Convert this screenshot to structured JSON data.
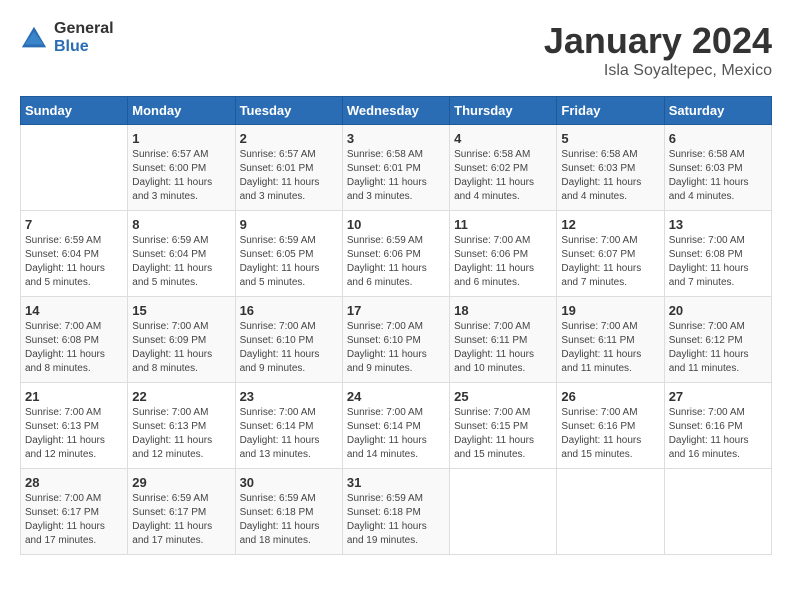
{
  "logo": {
    "general": "General",
    "blue": "Blue"
  },
  "title": "January 2024",
  "location": "Isla Soyaltepec, Mexico",
  "days_of_week": [
    "Sunday",
    "Monday",
    "Tuesday",
    "Wednesday",
    "Thursday",
    "Friday",
    "Saturday"
  ],
  "weeks": [
    [
      {
        "num": "",
        "info": ""
      },
      {
        "num": "1",
        "info": "Sunrise: 6:57 AM\nSunset: 6:00 PM\nDaylight: 11 hours\nand 3 minutes."
      },
      {
        "num": "2",
        "info": "Sunrise: 6:57 AM\nSunset: 6:01 PM\nDaylight: 11 hours\nand 3 minutes."
      },
      {
        "num": "3",
        "info": "Sunrise: 6:58 AM\nSunset: 6:01 PM\nDaylight: 11 hours\nand 3 minutes."
      },
      {
        "num": "4",
        "info": "Sunrise: 6:58 AM\nSunset: 6:02 PM\nDaylight: 11 hours\nand 4 minutes."
      },
      {
        "num": "5",
        "info": "Sunrise: 6:58 AM\nSunset: 6:03 PM\nDaylight: 11 hours\nand 4 minutes."
      },
      {
        "num": "6",
        "info": "Sunrise: 6:58 AM\nSunset: 6:03 PM\nDaylight: 11 hours\nand 4 minutes."
      }
    ],
    [
      {
        "num": "7",
        "info": "Sunrise: 6:59 AM\nSunset: 6:04 PM\nDaylight: 11 hours\nand 5 minutes."
      },
      {
        "num": "8",
        "info": "Sunrise: 6:59 AM\nSunset: 6:04 PM\nDaylight: 11 hours\nand 5 minutes."
      },
      {
        "num": "9",
        "info": "Sunrise: 6:59 AM\nSunset: 6:05 PM\nDaylight: 11 hours\nand 5 minutes."
      },
      {
        "num": "10",
        "info": "Sunrise: 6:59 AM\nSunset: 6:06 PM\nDaylight: 11 hours\nand 6 minutes."
      },
      {
        "num": "11",
        "info": "Sunrise: 7:00 AM\nSunset: 6:06 PM\nDaylight: 11 hours\nand 6 minutes."
      },
      {
        "num": "12",
        "info": "Sunrise: 7:00 AM\nSunset: 6:07 PM\nDaylight: 11 hours\nand 7 minutes."
      },
      {
        "num": "13",
        "info": "Sunrise: 7:00 AM\nSunset: 6:08 PM\nDaylight: 11 hours\nand 7 minutes."
      }
    ],
    [
      {
        "num": "14",
        "info": "Sunrise: 7:00 AM\nSunset: 6:08 PM\nDaylight: 11 hours\nand 8 minutes."
      },
      {
        "num": "15",
        "info": "Sunrise: 7:00 AM\nSunset: 6:09 PM\nDaylight: 11 hours\nand 8 minutes."
      },
      {
        "num": "16",
        "info": "Sunrise: 7:00 AM\nSunset: 6:10 PM\nDaylight: 11 hours\nand 9 minutes."
      },
      {
        "num": "17",
        "info": "Sunrise: 7:00 AM\nSunset: 6:10 PM\nDaylight: 11 hours\nand 9 minutes."
      },
      {
        "num": "18",
        "info": "Sunrise: 7:00 AM\nSunset: 6:11 PM\nDaylight: 11 hours\nand 10 minutes."
      },
      {
        "num": "19",
        "info": "Sunrise: 7:00 AM\nSunset: 6:11 PM\nDaylight: 11 hours\nand 11 minutes."
      },
      {
        "num": "20",
        "info": "Sunrise: 7:00 AM\nSunset: 6:12 PM\nDaylight: 11 hours\nand 11 minutes."
      }
    ],
    [
      {
        "num": "21",
        "info": "Sunrise: 7:00 AM\nSunset: 6:13 PM\nDaylight: 11 hours\nand 12 minutes."
      },
      {
        "num": "22",
        "info": "Sunrise: 7:00 AM\nSunset: 6:13 PM\nDaylight: 11 hours\nand 12 minutes."
      },
      {
        "num": "23",
        "info": "Sunrise: 7:00 AM\nSunset: 6:14 PM\nDaylight: 11 hours\nand 13 minutes."
      },
      {
        "num": "24",
        "info": "Sunrise: 7:00 AM\nSunset: 6:14 PM\nDaylight: 11 hours\nand 14 minutes."
      },
      {
        "num": "25",
        "info": "Sunrise: 7:00 AM\nSunset: 6:15 PM\nDaylight: 11 hours\nand 15 minutes."
      },
      {
        "num": "26",
        "info": "Sunrise: 7:00 AM\nSunset: 6:16 PM\nDaylight: 11 hours\nand 15 minutes."
      },
      {
        "num": "27",
        "info": "Sunrise: 7:00 AM\nSunset: 6:16 PM\nDaylight: 11 hours\nand 16 minutes."
      }
    ],
    [
      {
        "num": "28",
        "info": "Sunrise: 7:00 AM\nSunset: 6:17 PM\nDaylight: 11 hours\nand 17 minutes."
      },
      {
        "num": "29",
        "info": "Sunrise: 6:59 AM\nSunset: 6:17 PM\nDaylight: 11 hours\nand 17 minutes."
      },
      {
        "num": "30",
        "info": "Sunrise: 6:59 AM\nSunset: 6:18 PM\nDaylight: 11 hours\nand 18 minutes."
      },
      {
        "num": "31",
        "info": "Sunrise: 6:59 AM\nSunset: 6:18 PM\nDaylight: 11 hours\nand 19 minutes."
      },
      {
        "num": "",
        "info": ""
      },
      {
        "num": "",
        "info": ""
      },
      {
        "num": "",
        "info": ""
      }
    ]
  ]
}
